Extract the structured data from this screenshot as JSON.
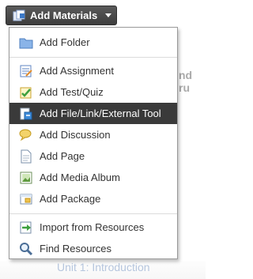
{
  "button": {
    "label": "Add Materials"
  },
  "background": {
    "right_text": "nd ru",
    "bottom_text": "Unit 1: Introduction"
  },
  "menu": {
    "items": [
      {
        "label": "Add Folder",
        "icon": "folder-icon"
      },
      {
        "label": "Add Assignment",
        "icon": "assignment-icon"
      },
      {
        "label": "Add Test/Quiz",
        "icon": "test-quiz-icon"
      },
      {
        "label": "Add File/Link/External Tool",
        "icon": "file-link-icon",
        "active": true
      },
      {
        "label": "Add Discussion",
        "icon": "discussion-icon"
      },
      {
        "label": "Add Page",
        "icon": "page-icon"
      },
      {
        "label": "Add Media Album",
        "icon": "media-album-icon"
      },
      {
        "label": "Add Package",
        "icon": "package-icon"
      },
      {
        "label": "Import from Resources",
        "icon": "import-icon"
      },
      {
        "label": "Find Resources",
        "icon": "search-icon"
      }
    ]
  },
  "colors": {
    "active_bg": "#3a3a3a",
    "active_text": "#ffffff",
    "button_bg": "#4a4a4a"
  }
}
